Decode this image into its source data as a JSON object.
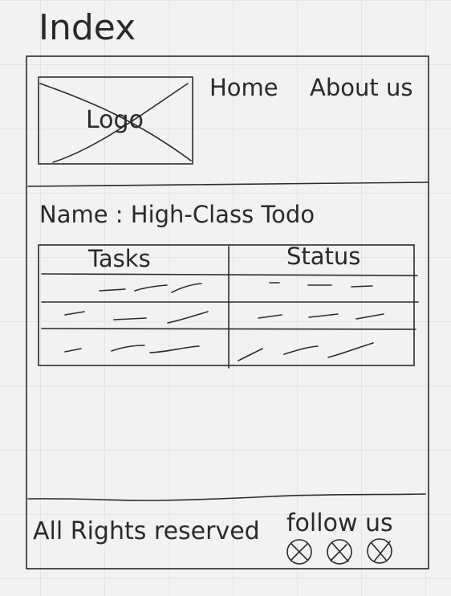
{
  "page": {
    "title": "Index"
  },
  "header": {
    "logo_label": "Logo",
    "nav": [
      {
        "label": "Home"
      },
      {
        "label": "About us"
      }
    ]
  },
  "main": {
    "name_line": "Name : High-Class Todo",
    "table": {
      "columns": [
        "Tasks",
        "Status"
      ],
      "row_count": 3,
      "cell_content": "placeholder scribbles"
    }
  },
  "footer": {
    "rights": "All Rights reserved",
    "follow": "follow us",
    "social_icons": [
      "social-icon",
      "social-icon",
      "social-icon"
    ]
  }
}
